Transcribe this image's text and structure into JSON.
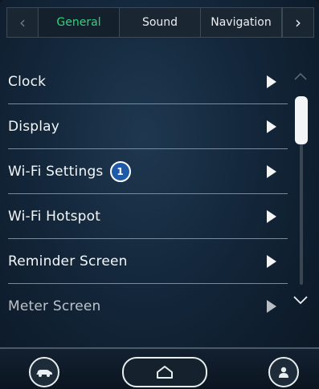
{
  "tabs": [
    {
      "label": "General",
      "active": true
    },
    {
      "label": "Sound",
      "active": false
    },
    {
      "label": "Navigation",
      "active": false
    }
  ],
  "menu": {
    "items": [
      {
        "label": "Clock"
      },
      {
        "label": "Display"
      },
      {
        "label": "Wi-Fi Settings",
        "badge": "1"
      },
      {
        "label": "Wi-Fi Hotspot"
      },
      {
        "label": "Reminder Screen"
      },
      {
        "label": "Meter Screen"
      }
    ]
  },
  "icons": {
    "tab_prev": "chevron-left-icon",
    "tab_next": "chevron-right-icon",
    "scroll_up": "chevron-up-icon",
    "scroll_down": "chevron-down-icon",
    "car": "car-icon",
    "home": "home-icon",
    "profile": "person-icon"
  },
  "colors": {
    "active_tab": "#2bd67b",
    "badge": "#1e5aa8"
  }
}
